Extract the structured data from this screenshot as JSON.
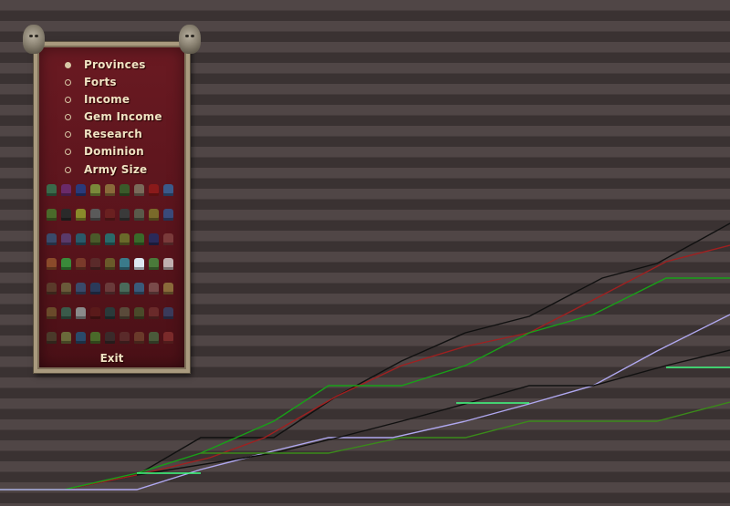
{
  "menu": {
    "options": [
      {
        "label": "Provinces",
        "selected": true
      },
      {
        "label": "Forts",
        "selected": false
      },
      {
        "label": "Income",
        "selected": false
      },
      {
        "label": "Gem Income",
        "selected": false
      },
      {
        "label": "Research",
        "selected": false
      },
      {
        "label": "Dominion",
        "selected": false
      },
      {
        "label": "Army Size",
        "selected": false
      }
    ],
    "exit_label": "Exit"
  },
  "colors": {
    "stripe_dark": "#3a3232",
    "stripe_light": "#504646",
    "panel_red": "#5e161e",
    "panel_border": "#a99a7e",
    "menu_text": "#f0e2c2"
  },
  "nation_icons": [
    [
      "#3a6a4a",
      "#6a2a6a",
      "#2a3a7a",
      "#7a8a3a",
      "#8a6a3a",
      "#3a5a2a",
      "#7a6a5a",
      "#8a1a1a",
      "#3a5a8a"
    ],
    [
      "#4a6a2a",
      "#2a2a2a",
      "#8a8a2a",
      "#5a5a5a",
      "#6a2020",
      "#3a3a3a",
      "#5a5a4a",
      "#7a6a2a",
      "#3a4a7a"
    ],
    [
      "#3a4a6a",
      "#5a3a6a",
      "#2a5a6a",
      "#4a5a2a",
      "#2a6a6a",
      "#6a6a2a",
      "#3a6a2a",
      "#2a2a5a",
      "#7a3a3a"
    ],
    [
      "#8a4a2a",
      "#3a8a3a",
      "#7a3a2a",
      "#5a2a2a",
      "#6a5a2a",
      "#3a7a8a",
      "#dce8f0",
      "#4a7a3a",
      "#c0b0b0"
    ],
    [
      "#5a3a2a",
      "#6a5a3a",
      "#3a4a6a",
      "#2a3a5a",
      "#6a3a3a",
      "#4a6a5a",
      "#3a5a7a",
      "#7a4a4a",
      "#8a6a3a"
    ],
    [
      "#6a4a2a",
      "#3a5a4a",
      "#8a8a8a",
      "#5a1a1a",
      "#2a3a3a",
      "#5a4a3a",
      "#4a4a2a",
      "#6a2a2a",
      "#3a3a5a"
    ],
    [
      "#4a3a2a",
      "#6a6a3a",
      "#2a4a6a",
      "#4a6a2a",
      "#3a2a2a",
      "#5a2a2a",
      "#6a3a2a",
      "#4a5a3a",
      "#7a2a2a"
    ]
  ],
  "chart_data": {
    "type": "line",
    "title": "",
    "xlabel": "",
    "ylabel": "",
    "grid": true,
    "series": [
      {
        "color": "#101010",
        "points": [
          [
            0,
            0
          ],
          [
            70,
            0
          ],
          [
            150,
            16
          ],
          [
            220,
            57
          ],
          [
            300,
            57
          ],
          [
            370,
            103
          ],
          [
            440,
            141
          ],
          [
            510,
            172
          ],
          [
            580,
            190
          ],
          [
            660,
            232
          ],
          [
            720,
            248
          ],
          [
            800,
            292
          ]
        ]
      },
      {
        "color": "#a02020",
        "points": [
          [
            0,
            0
          ],
          [
            70,
            0
          ],
          [
            150,
            16
          ],
          [
            230,
            35
          ],
          [
            290,
            57
          ],
          [
            370,
            103
          ],
          [
            440,
            136
          ],
          [
            510,
            157
          ],
          [
            580,
            172
          ],
          [
            650,
            208
          ],
          [
            730,
            250
          ],
          [
            800,
            268
          ]
        ]
      },
      {
        "color": "#18a018",
        "points": [
          [
            0,
            0
          ],
          [
            70,
            0
          ],
          [
            150,
            18
          ],
          [
            220,
            40
          ],
          [
            300,
            75
          ],
          [
            360,
            114
          ],
          [
            440,
            114
          ],
          [
            510,
            136
          ],
          [
            580,
            172
          ],
          [
            650,
            192
          ],
          [
            730,
            232
          ],
          [
            800,
            232
          ]
        ]
      },
      {
        "color": "#b0a8f0",
        "points": [
          [
            0,
            0
          ],
          [
            150,
            0
          ],
          [
            220,
            22
          ],
          [
            290,
            40
          ],
          [
            360,
            57
          ],
          [
            430,
            57
          ],
          [
            510,
            75
          ],
          [
            580,
            94
          ],
          [
            650,
            114
          ],
          [
            720,
            152
          ],
          [
            800,
            192
          ]
        ]
      },
      {
        "color": "#101010",
        "points": [
          [
            150,
            16
          ],
          [
            300,
            40
          ],
          [
            370,
            57
          ],
          [
            440,
            75
          ],
          [
            510,
            94
          ],
          [
            580,
            114
          ],
          [
            650,
            114
          ],
          [
            730,
            136
          ],
          [
            800,
            153
          ]
        ]
      },
      {
        "color": "#40ff80",
        "points": [
          [
            150,
            18
          ],
          [
            220,
            18
          ]
        ]
      },
      {
        "color": "#40ff80",
        "points": [
          [
            500,
            95
          ],
          [
            580,
            95
          ]
        ]
      },
      {
        "color": "#40ff80",
        "points": [
          [
            730,
            134
          ],
          [
            800,
            134
          ]
        ]
      },
      {
        "color": "#3a8a1a",
        "points": [
          [
            220,
            40
          ],
          [
            360,
            40
          ],
          [
            440,
            57
          ],
          [
            510,
            57
          ],
          [
            580,
            75
          ],
          [
            720,
            75
          ],
          [
            800,
            96
          ]
        ]
      }
    ]
  }
}
